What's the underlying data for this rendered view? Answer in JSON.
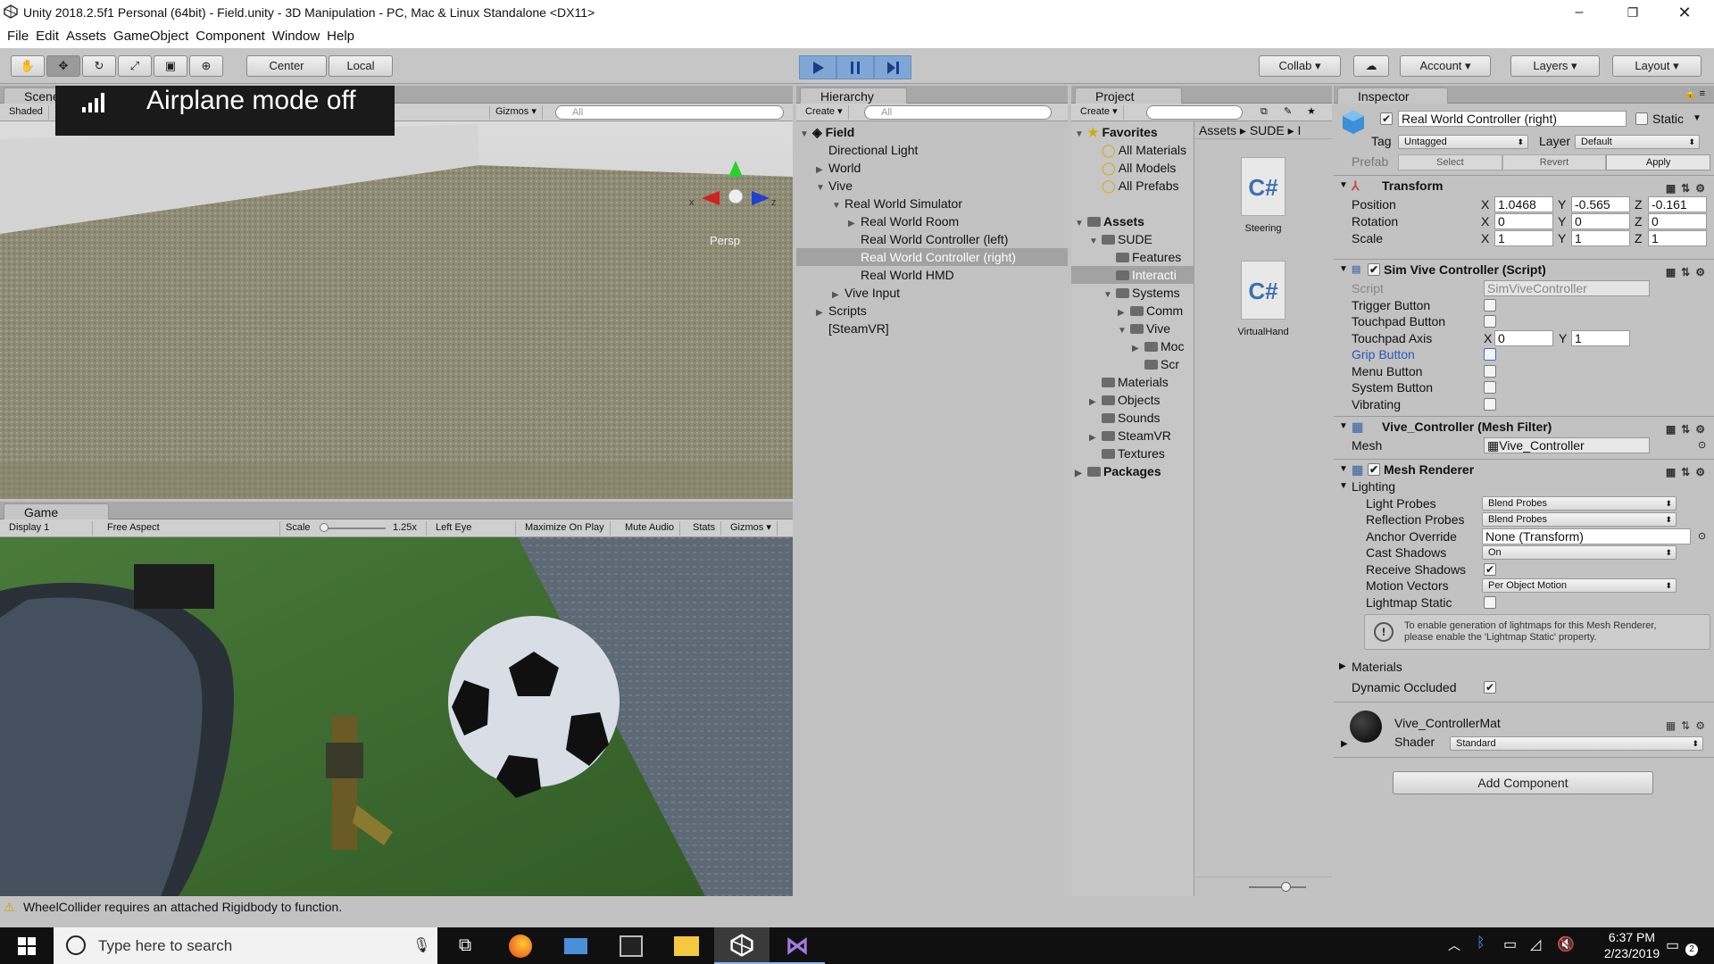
{
  "window": {
    "title": "Unity 2018.2.5f1 Personal (64bit) - Field.unity - 3D Manipulation - PC, Mac & Linux Standalone <DX11>"
  },
  "menu": [
    "File",
    "Edit",
    "Assets",
    "GameObject",
    "Component",
    "Window",
    "Help"
  ],
  "toolbar": {
    "center_label": "Center",
    "local_label": "Local",
    "collab_label": "Collab",
    "account_label": "Account",
    "layers_label": "Layers",
    "layout_label": "Layout"
  },
  "notification": {
    "text": "Airplane mode off"
  },
  "scene": {
    "tab": "Scene",
    "shaded": "Shaded",
    "gizmos": "Gizmos",
    "search": "All",
    "persp": "Persp",
    "axis_x": "x",
    "axis_z": "z"
  },
  "game": {
    "tab": "Game",
    "display": "Display 1",
    "aspect": "Free Aspect",
    "scale_label": "Scale",
    "scale_value": "1.25x",
    "eye": "Left Eye",
    "maximize": "Maximize On Play",
    "mute": "Mute Audio",
    "stats": "Stats",
    "gizmos": "Gizmos"
  },
  "hierarchy": {
    "tab": "Hierarchy",
    "create": "Create",
    "search": "All",
    "scene_name": "Field",
    "items": [
      {
        "label": "Directional Light",
        "indent": 1,
        "arrow": ""
      },
      {
        "label": "World",
        "indent": 1,
        "arrow": "▶"
      },
      {
        "label": "Vive",
        "indent": 1,
        "arrow": "▼"
      },
      {
        "label": "Real World Simulator",
        "indent": 2,
        "arrow": "▼"
      },
      {
        "label": "Real World Room",
        "indent": 3,
        "arrow": "▶"
      },
      {
        "label": "Real World Controller (left)",
        "indent": 3,
        "arrow": ""
      },
      {
        "label": "Real World Controller (right)",
        "indent": 3,
        "arrow": "",
        "selected": true
      },
      {
        "label": "Real World HMD",
        "indent": 3,
        "arrow": ""
      },
      {
        "label": "Vive Input",
        "indent": 2,
        "arrow": "▶"
      },
      {
        "label": "Scripts",
        "indent": 1,
        "arrow": "▶"
      },
      {
        "label": "[SteamVR]",
        "indent": 1,
        "arrow": ""
      }
    ]
  },
  "project": {
    "tab": "Project",
    "create": "Create",
    "tree": [
      {
        "label": "Favorites",
        "indent": 0,
        "arrow": "▼",
        "bold": true,
        "icon": "star"
      },
      {
        "label": "All Materials",
        "indent": 1,
        "arrow": "",
        "icon": "search"
      },
      {
        "label": "All Models",
        "indent": 1,
        "arrow": "",
        "icon": "search"
      },
      {
        "label": "All Prefabs",
        "indent": 1,
        "arrow": "",
        "icon": "search"
      },
      {
        "label": "",
        "indent": 0,
        "arrow": "",
        "icon": "none"
      },
      {
        "label": "Assets",
        "indent": 0,
        "arrow": "▼",
        "bold": true,
        "icon": "folder"
      },
      {
        "label": "SUDE",
        "indent": 1,
        "arrow": "▼",
        "icon": "folder"
      },
      {
        "label": "Features",
        "indent": 2,
        "arrow": "",
        "icon": "folder"
      },
      {
        "label": "Interacti",
        "indent": 2,
        "arrow": "",
        "icon": "folder",
        "selected": true
      },
      {
        "label": "Systems",
        "indent": 2,
        "arrow": "▼",
        "icon": "folder"
      },
      {
        "label": "Comm",
        "indent": 3,
        "arrow": "▶",
        "icon": "folder"
      },
      {
        "label": "Vive",
        "indent": 3,
        "arrow": "▼",
        "icon": "folder"
      },
      {
        "label": "Moc",
        "indent": 4,
        "arrow": "▶",
        "icon": "folder"
      },
      {
        "label": "Scr",
        "indent": 4,
        "arrow": "",
        "icon": "folder"
      },
      {
        "label": "Materials",
        "indent": 1,
        "arrow": "",
        "icon": "folder"
      },
      {
        "label": "Objects",
        "indent": 1,
        "arrow": "▶",
        "icon": "folder"
      },
      {
        "label": "Sounds",
        "indent": 1,
        "arrow": "",
        "icon": "folder"
      },
      {
        "label": "SteamVR",
        "indent": 1,
        "arrow": "▶",
        "icon": "folder"
      },
      {
        "label": "Textures",
        "indent": 1,
        "arrow": "",
        "icon": "folder"
      },
      {
        "label": "Packages",
        "indent": 0,
        "arrow": "▶",
        "bold": true,
        "icon": "folder"
      }
    ],
    "breadcrumb": [
      "Assets",
      "SUDE",
      "I"
    ],
    "files": [
      {
        "name": "Steering",
        "type": "C#"
      },
      {
        "name": "VirtualHand",
        "type": "C#"
      }
    ]
  },
  "inspector": {
    "tab": "Inspector",
    "object_name": "Real World Controller (right)",
    "static_label": "Static",
    "tag_label": "Tag",
    "tag_value": "Untagged",
    "layer_label": "Layer",
    "layer_value": "Default",
    "prefab_label": "Prefab",
    "select": "Select",
    "revert": "Revert",
    "apply": "Apply",
    "transform": {
      "title": "Transform",
      "rows": [
        {
          "label": "Position",
          "x": "1.0468",
          "y": "-0.565",
          "z": "-0.161"
        },
        {
          "label": "Rotation",
          "x": "0",
          "y": "0",
          "z": "0"
        },
        {
          "label": "Scale",
          "x": "1",
          "y": "1",
          "z": "1"
        }
      ]
    },
    "sim": {
      "title": "Sim Vive Controller (Script)",
      "script_label": "Script",
      "script_value": "SimViveController",
      "trigger": "Trigger Button",
      "touchpad_button": "Touchpad Button",
      "touchpad_axis": "Touchpad Axis",
      "axis_x": "0",
      "axis_y": "1",
      "grip": "Grip Button",
      "menu": "Menu Button",
      "system": "System Button",
      "vibrating": "Vibrating"
    },
    "meshfilter": {
      "title": "Vive_Controller (Mesh Filter)",
      "mesh_label": "Mesh",
      "mesh_value": "Vive_Controller"
    },
    "renderer": {
      "title": "Mesh Renderer",
      "lighting": "Lighting",
      "light_probes": "Light Probes",
      "light_probes_value": "Blend Probes",
      "reflection_probes": "Reflection Probes",
      "reflection_probes_value": "Blend Probes",
      "anchor": "Anchor Override",
      "anchor_value": "None (Transform)",
      "cast": "Cast Shadows",
      "cast_value": "On",
      "receive": "Receive Shadows",
      "motion": "Motion Vectors",
      "motion_value": "Per Object Motion",
      "lightmap": "Lightmap Static",
      "info_line1": "To enable generation of lightmaps for this Mesh Renderer,",
      "info_line2": "please enable the 'Lightmap Static' property.",
      "materials": "Materials",
      "dynamic": "Dynamic Occluded"
    },
    "material": {
      "name": "Vive_ControllerMat",
      "shader_label": "Shader",
      "shader_value": "Standard"
    },
    "add_component": "Add Component"
  },
  "status": {
    "message": "WheelCollider requires an attached Rigidbody to function."
  },
  "taskbar": {
    "search_placeholder": "Type here to search",
    "time": "6:37 PM",
    "date": "2/23/2019",
    "notif_count": "2"
  }
}
